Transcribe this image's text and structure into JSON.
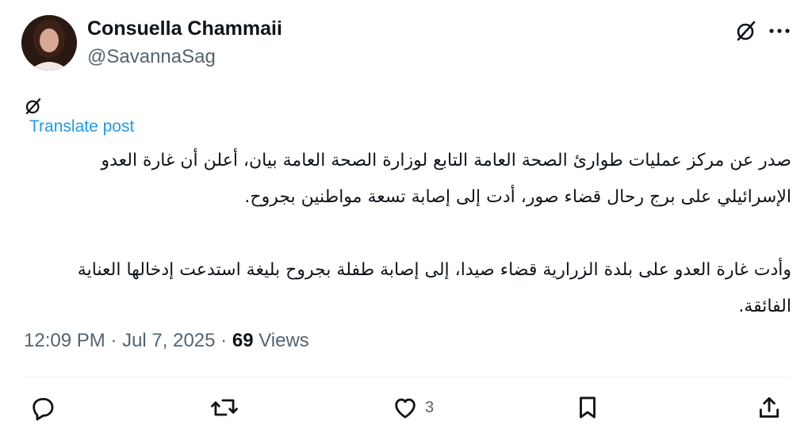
{
  "author": {
    "display_name": "Consuella Chammaii",
    "handle": "@SavannaSag"
  },
  "header": {
    "icons": [
      "grok-icon",
      "more-icon"
    ]
  },
  "post": {
    "translate_label": "Translate post",
    "paragraph_1": "صدر عن مركز عمليات طوارئ الصحة العامة التابع لوزارة الصحة العامة بيان، أعلن أن غارة العدو الإسرائيلي على برج رحال قضاء صور، أدت إلى إصابة تسعة مواطنين بجروح.",
    "paragraph_2": "وأدت غارة العدو على بلدة الزرارية قضاء صيدا، إلى إصابة طفلة بجروح بليغة استدعت إدخالها العناية الفائقة."
  },
  "meta": {
    "time": "12:09 PM",
    "separator": "·",
    "date": "Jul 7, 2025",
    "views_count": "69",
    "views_label": "Views"
  },
  "actions": {
    "likes_count": "3",
    "icons": [
      "reply-icon",
      "repost-icon",
      "like-icon",
      "bookmark-icon",
      "share-icon"
    ]
  },
  "colors": {
    "text": "#0f1419",
    "secondary": "#536471",
    "link": "#1d9bf0",
    "divider": "#eff3f4"
  }
}
